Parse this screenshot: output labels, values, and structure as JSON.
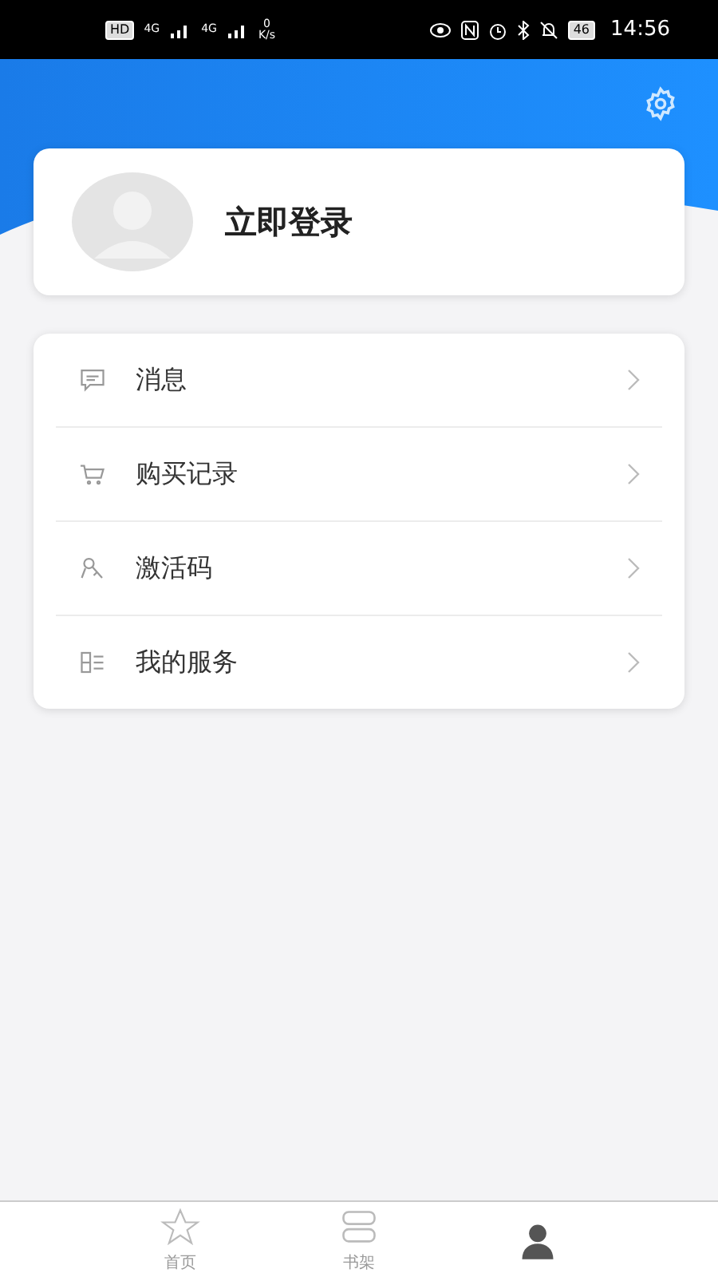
{
  "status_bar": {
    "hd_label": "HD",
    "network_left": "4G",
    "network_right": "4G",
    "speed_value": "0",
    "speed_unit": "K/s",
    "battery": "46",
    "time": "14:56"
  },
  "profile": {
    "login_label": "立即登录"
  },
  "menu": [
    {
      "label": "消息",
      "kind": "message"
    },
    {
      "label": "购买记录",
      "kind": "cart"
    },
    {
      "label": "激活码",
      "kind": "key"
    },
    {
      "label": "我的服务",
      "kind": "service"
    }
  ],
  "tabs": [
    {
      "label": "首页",
      "kind": "star",
      "selected": false
    },
    {
      "label": "书架",
      "kind": "shelf",
      "selected": false
    },
    {
      "kind": "person",
      "selected": true
    }
  ]
}
